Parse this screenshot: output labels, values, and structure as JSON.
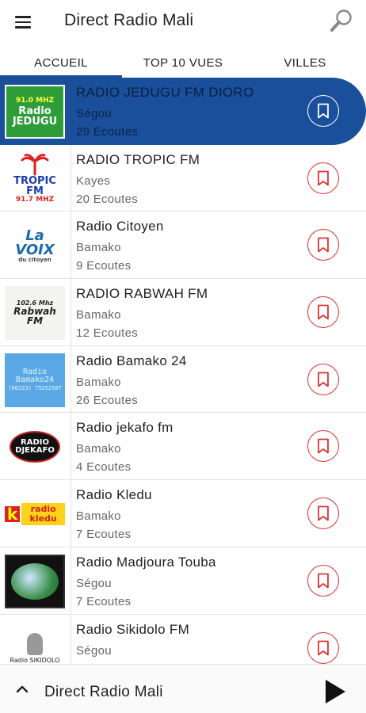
{
  "header": {
    "title": "Direct Radio Mali"
  },
  "tabs": [
    {
      "label": "ACCUEIL",
      "active": true
    },
    {
      "label": "TOP 10 VUES",
      "active": false
    },
    {
      "label": "VILLES",
      "active": false
    }
  ],
  "stations": [
    {
      "name": "RADIO JEDUGU FM DIORO",
      "city": "Ségou",
      "listens": "29 Ecoutes",
      "logo_text": "Radio JEDUGU",
      "logo_freq": "91.0 MHZ",
      "selected": true
    },
    {
      "name": "RADIO TROPIC FM",
      "city": "Kayes",
      "listens": "20 Ecoutes",
      "logo_text": "TROPIC FM",
      "logo_freq": "91.7 MHZ"
    },
    {
      "name": "Radio Citoyen",
      "city": "Bamako",
      "listens": "9 Ecoutes",
      "logo_text": "La VOIX",
      "logo_sub": "du citoyen"
    },
    {
      "name": "RADIO RABWAH FM",
      "city": "Bamako",
      "listens": "12 Ecoutes",
      "logo_text": "Rabwah FM",
      "logo_freq": "102.6 Mhz"
    },
    {
      "name": "Radio Bamako 24",
      "city": "Bamako",
      "listens": "26 Ecoutes",
      "logo_text": "Radio Bamako24",
      "logo_phone": "(00223) 75252587"
    },
    {
      "name": "Radio jekafo fm",
      "city": "Bamako",
      "listens": "4 Ecoutes",
      "logo_text": "RADIO DJEKAFO"
    },
    {
      "name": "Radio Kledu",
      "city": "Bamako",
      "listens": "7 Ecoutes",
      "logo_k": "k",
      "logo_text": "radio kledu"
    },
    {
      "name": "Radio Madjoura Touba",
      "city": "Ségou",
      "listens": "7 Ecoutes",
      "logo_text": ""
    },
    {
      "name": "Radio Sikidolo FM",
      "city": "Ségou",
      "listens": "",
      "logo_text": "Radio SIKIDOLO"
    }
  ],
  "player": {
    "title": "Direct Radio Mali"
  },
  "colors": {
    "primary": "#1a4f9c",
    "favorite": "#dd3333"
  }
}
